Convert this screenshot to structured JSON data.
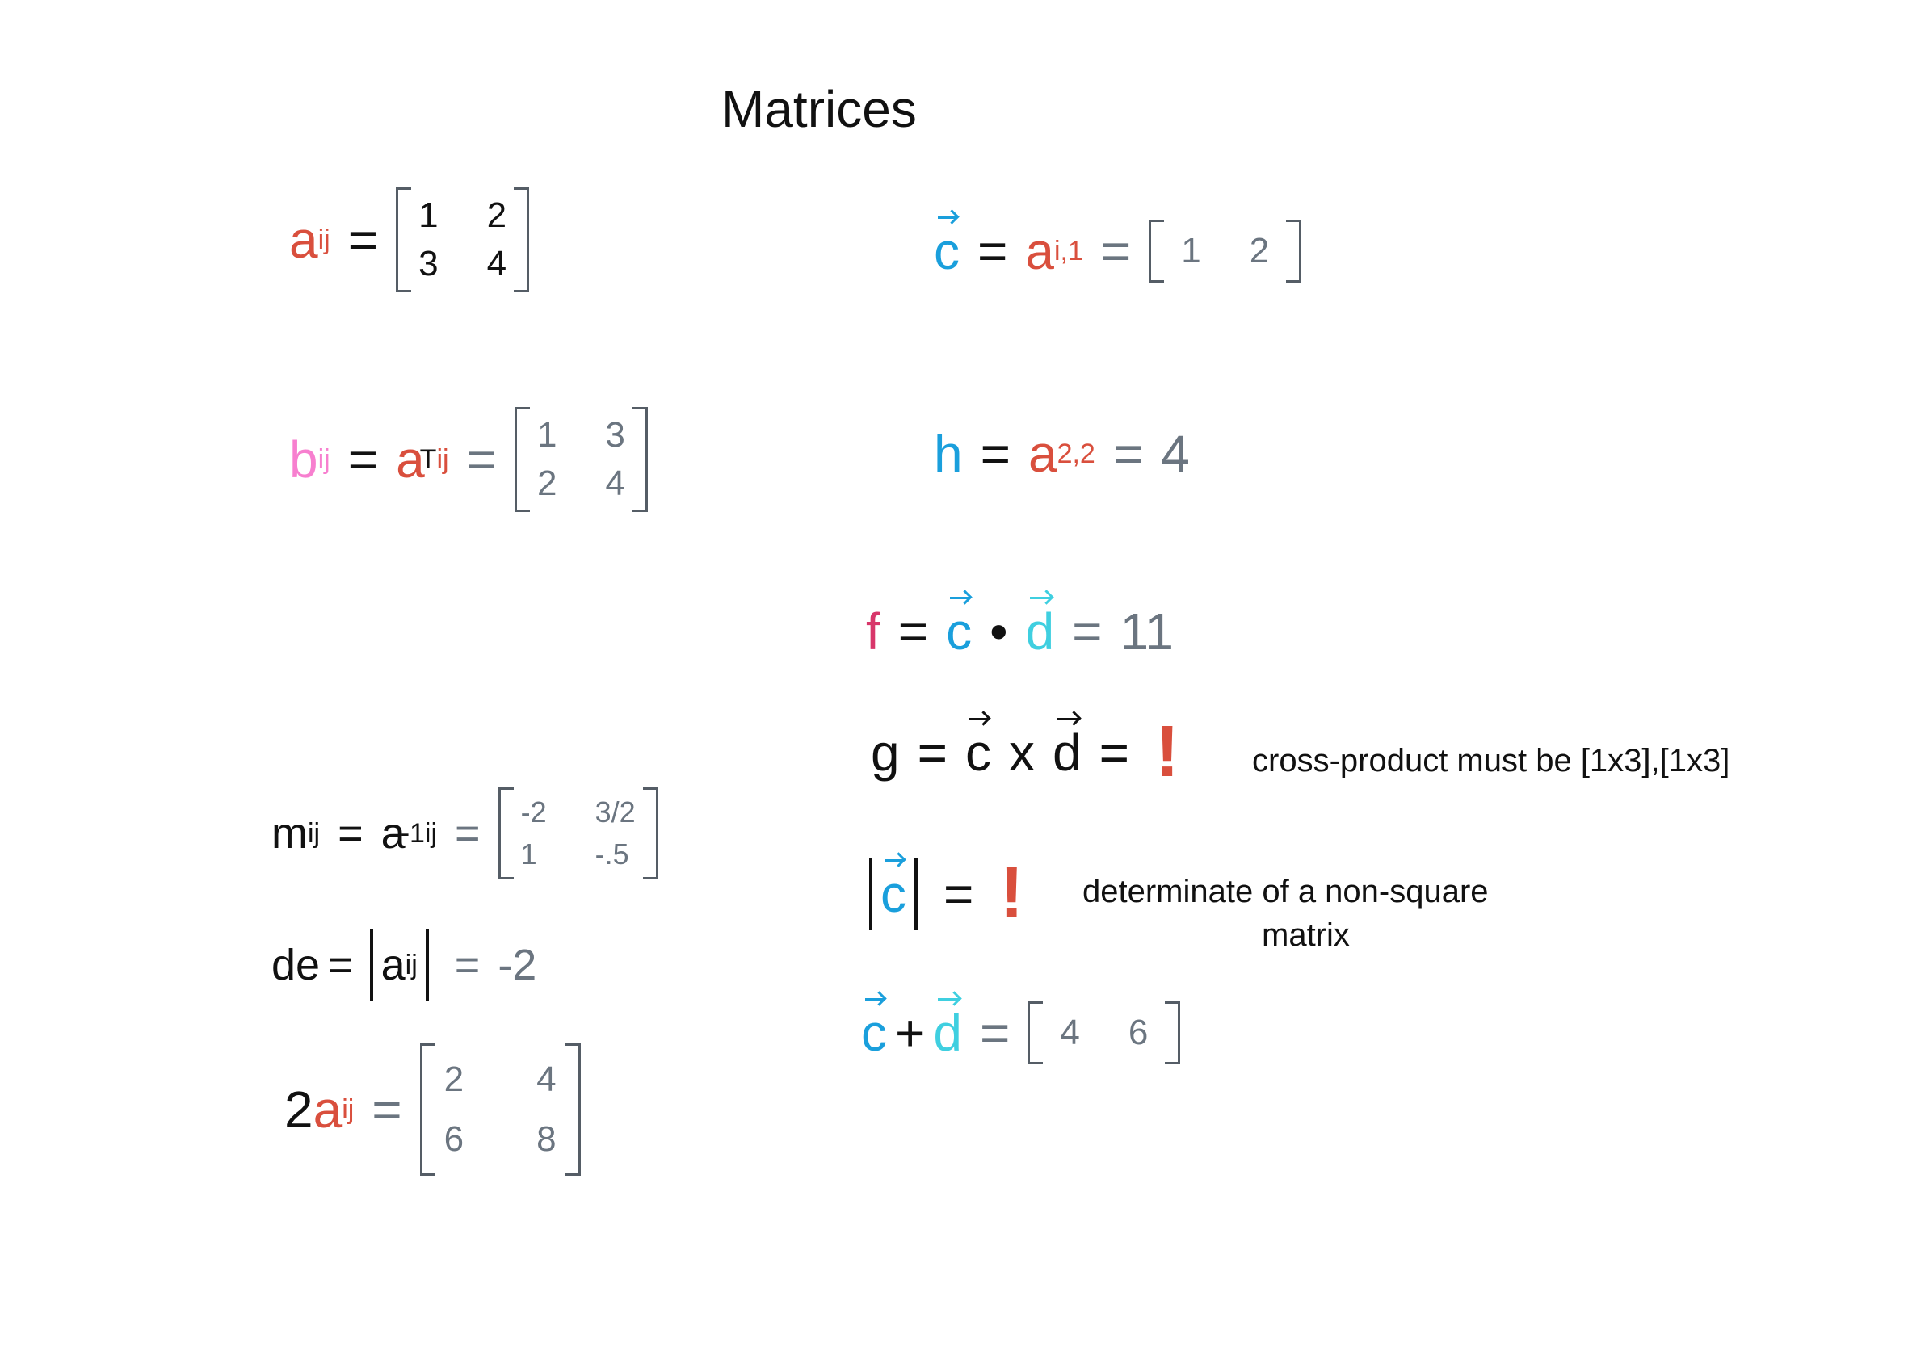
{
  "title": "Matrices",
  "a_def": {
    "lhs": "a",
    "lhs_sub": "ij",
    "eq": "=",
    "matrix": [
      [
        "1",
        "2"
      ],
      [
        "3",
        "4"
      ]
    ]
  },
  "b_def": {
    "lhs": "b",
    "lhs_sub": "ij",
    "eq": "=",
    "mid": "a",
    "mid_sup": "T",
    "mid_sub": "ij",
    "eq2": "=",
    "matrix": [
      [
        "1",
        "3"
      ],
      [
        "2",
        "4"
      ]
    ]
  },
  "c_def": {
    "lhs": "c",
    "eq": "=",
    "mid": "a",
    "mid_sub": "i,1",
    "eq2": "=",
    "matrix": [
      [
        "1",
        "2"
      ]
    ]
  },
  "h_def": {
    "lhs": "h",
    "eq": "=",
    "mid": "a",
    "mid_sub": "2,2",
    "eq2": "=",
    "result": "4"
  },
  "f_def": {
    "lhs": "f",
    "eq": "=",
    "c": "c",
    "op": "•",
    "d": "d",
    "eq2": "=",
    "result": "11"
  },
  "g_def": {
    "lhs": "g",
    "eq": "=",
    "c": "c",
    "op": "x",
    "d": "d",
    "eq2": "=",
    "result": "!",
    "note": "cross-product must be [1x3],[1x3]"
  },
  "norm_def": {
    "c": "c",
    "eq": "=",
    "result": "!",
    "note": "determinate of a non-square",
    "note2": "matrix"
  },
  "sum_def": {
    "c": "c",
    "op": "+",
    "d": "d",
    "eq": "=",
    "matrix": [
      [
        "4",
        "6"
      ]
    ]
  },
  "m_def": {
    "lhs": "m",
    "lhs_sub": "ij",
    "eq": "=",
    "mid": "a",
    "mid_sup": "-1",
    "mid_sub": "ij",
    "eq2": "=",
    "matrix": [
      [
        "-2",
        "3/2"
      ],
      [
        "1",
        "-.5"
      ]
    ]
  },
  "de_def": {
    "lhs": "de",
    "eq": "=",
    "mid": "a",
    "mid_sub": "ij",
    "eq2": "=",
    "result": "-2"
  },
  "scale_def": {
    "k": "2",
    "mid": "a",
    "mid_sub": "ij",
    "eq": "=",
    "matrix": [
      [
        "2",
        "4"
      ],
      [
        "6",
        "8"
      ]
    ]
  },
  "colors": {
    "red": "#d94f3d",
    "blue": "#1a9fdc",
    "pink": "#f77fcf",
    "cyan": "#3fcfe0",
    "magenta": "#d8366a",
    "gray": "#6b7580"
  }
}
